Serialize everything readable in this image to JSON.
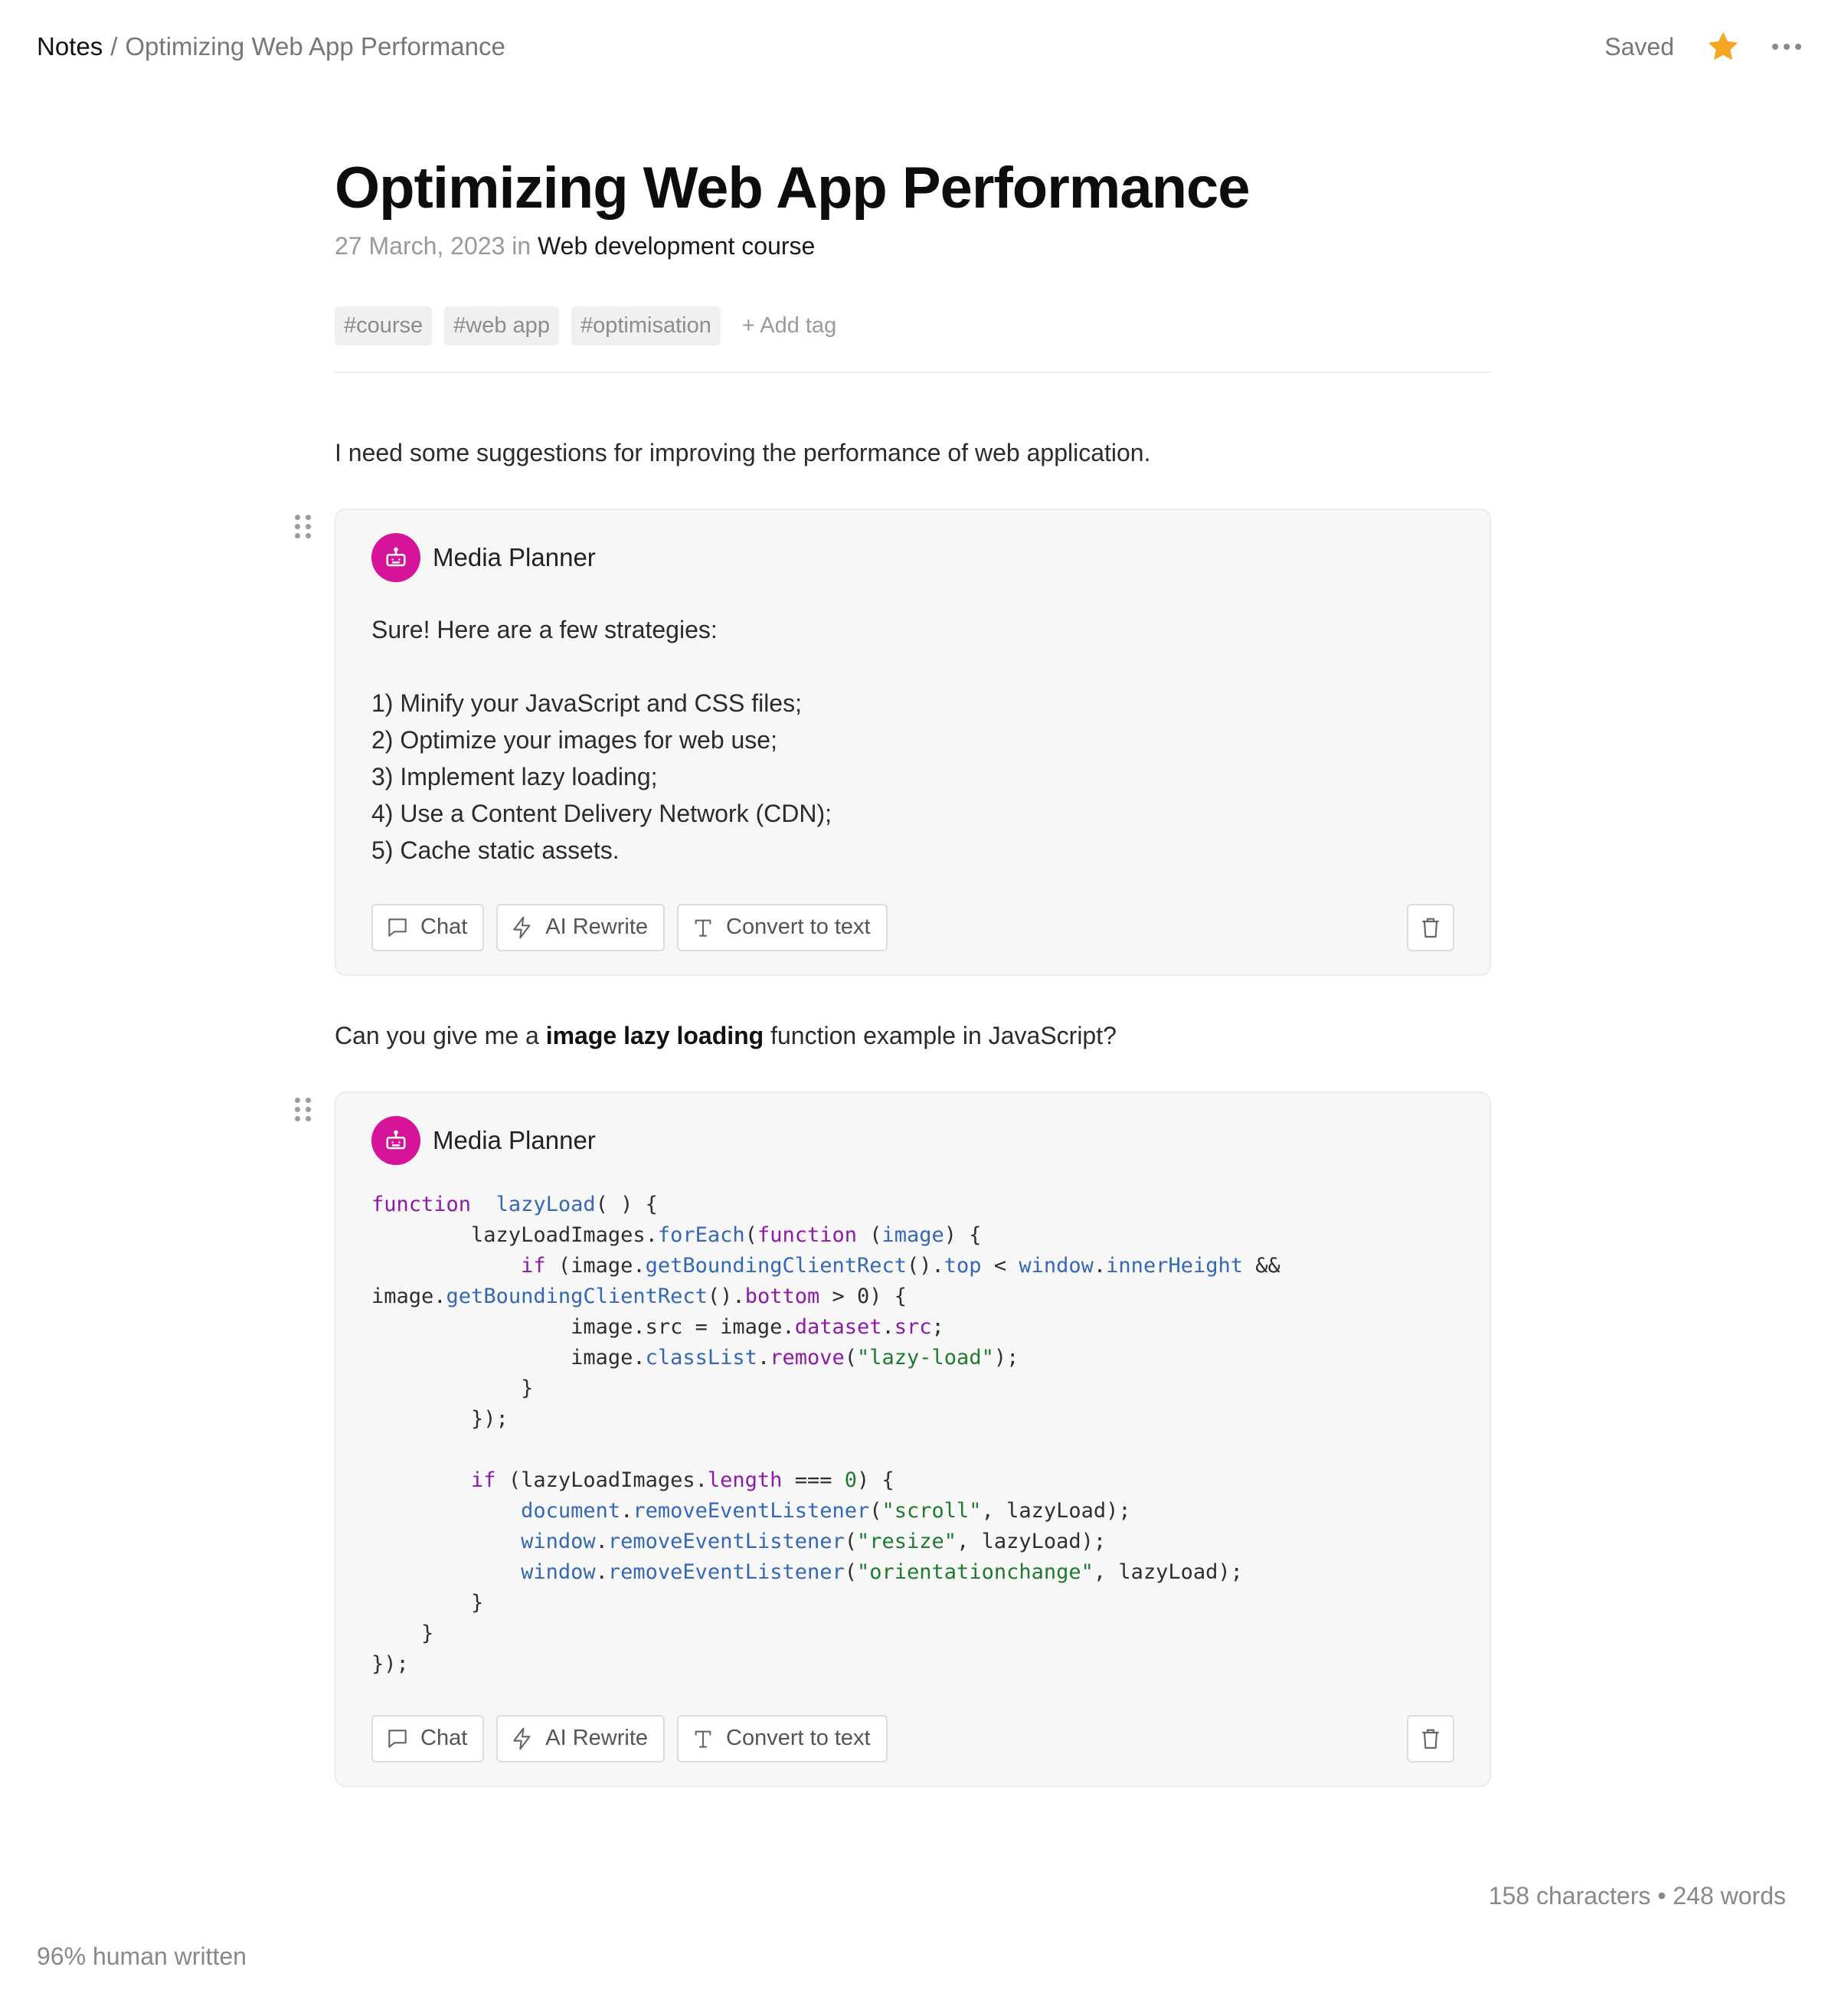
{
  "breadcrumb": {
    "root": "Notes",
    "separator": "/",
    "current": "Optimizing Web App Performance"
  },
  "header": {
    "status": "Saved",
    "star_icon": "star-icon",
    "more_icon": "more-horizontal-icon",
    "accent": "#f5a623"
  },
  "note": {
    "title": "Optimizing Web App Performance",
    "date": "27 March, 2023",
    "in_word": "in",
    "course": "Web development course",
    "tags": [
      "#course",
      "#web app",
      "#optimisation"
    ],
    "add_tag": "+ Add tag"
  },
  "prompt1": "I need some suggestions for improving the performance of web application.",
  "response1": {
    "agent": "Media Planner",
    "intro": "Sure! Here are a few strategies:",
    "items": [
      "1) Minify your JavaScript and CSS files;",
      "2) Optimize your images for web use;",
      "3) Implement lazy loading;",
      "4) Use a Content Delivery Network (CDN);",
      "5) Cache static assets."
    ]
  },
  "prompt2": {
    "before": "Can you give me a ",
    "bold": "image lazy loading",
    "after": " function example in JavaScript?"
  },
  "response2": {
    "agent": "Media Planner",
    "code_lines": [
      [
        [
          "kw",
          "function"
        ],
        [
          "",
          "  "
        ],
        [
          "fn",
          "lazyLoad"
        ],
        [
          "",
          "( ) {"
        ]
      ],
      [
        [
          "",
          "        lazyLoadImages."
        ],
        [
          "fn",
          "forEach"
        ],
        [
          "",
          "("
        ],
        [
          "kw",
          "function"
        ],
        [
          "",
          " ("
        ],
        [
          "pr",
          "image"
        ],
        [
          "",
          ") {"
        ]
      ],
      [
        [
          "",
          "            "
        ],
        [
          "kw",
          "if"
        ],
        [
          "",
          " (image."
        ],
        [
          "fn",
          "getBoundingClientRect"
        ],
        [
          "",
          "()."
        ],
        [
          "pr",
          "top"
        ],
        [
          "",
          " < "
        ],
        [
          "pr",
          "window"
        ],
        [
          "",
          "."
        ],
        [
          "pr",
          "innerHeight"
        ],
        [
          "",
          " &&"
        ]
      ],
      [
        [
          "",
          "image."
        ],
        [
          "fn",
          "getBoundingClientRect"
        ],
        [
          "",
          "()."
        ],
        [
          "kw",
          "bottom"
        ],
        [
          "",
          " > 0) {"
        ]
      ],
      [
        [
          "",
          "                image.src = image."
        ],
        [
          "kw",
          "dataset"
        ],
        [
          "",
          "."
        ],
        [
          "kw",
          "src"
        ],
        [
          "",
          ";"
        ]
      ],
      [
        [
          "",
          "                image."
        ],
        [
          "fn",
          "classList"
        ],
        [
          "",
          "."
        ],
        [
          "kw",
          "remove"
        ],
        [
          "",
          "("
        ],
        [
          "str",
          "\"lazy-load\""
        ],
        [
          "",
          ");"
        ]
      ],
      [
        [
          "",
          "            }"
        ]
      ],
      [
        [
          "",
          "        });"
        ]
      ],
      [
        [
          "",
          ""
        ]
      ],
      [
        [
          "",
          "        "
        ],
        [
          "kw",
          "if"
        ],
        [
          "",
          " (lazyLoadImages."
        ],
        [
          "kw",
          "length"
        ],
        [
          "",
          " === "
        ],
        [
          "num",
          "0"
        ],
        [
          "",
          ") {"
        ]
      ],
      [
        [
          "",
          "            "
        ],
        [
          "pr",
          "document"
        ],
        [
          "",
          "."
        ],
        [
          "fn",
          "removeEventListener"
        ],
        [
          "",
          "("
        ],
        [
          "str",
          "\"scroll\""
        ],
        [
          "",
          ", lazyLoad);"
        ]
      ],
      [
        [
          "",
          "            "
        ],
        [
          "pr",
          "window"
        ],
        [
          "",
          "."
        ],
        [
          "fn",
          "removeEventListener"
        ],
        [
          "",
          "("
        ],
        [
          "str",
          "\"resize\""
        ],
        [
          "",
          ", lazyLoad);"
        ]
      ],
      [
        [
          "",
          "            "
        ],
        [
          "pr",
          "window"
        ],
        [
          "",
          "."
        ],
        [
          "fn",
          "removeEventListener"
        ],
        [
          "",
          "("
        ],
        [
          "str",
          "\"orientationchange\""
        ],
        [
          "",
          ", lazyLoad);"
        ]
      ],
      [
        [
          "",
          "        }"
        ]
      ],
      [
        [
          "",
          "    }"
        ]
      ],
      [
        [
          "",
          "});"
        ]
      ]
    ]
  },
  "card_actions": {
    "chat": "Chat",
    "rewrite": "AI Rewrite",
    "convert": "Convert to text"
  },
  "footer": {
    "counts": "158 characters • 248 words",
    "human": "96% human written"
  },
  "colors": {
    "avatar": "#d6149a",
    "keyword": "#8d1aa8",
    "function": "#3468b5",
    "string": "#1e7b2d"
  }
}
